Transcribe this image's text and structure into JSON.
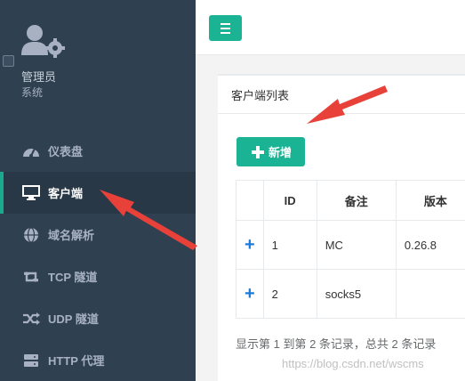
{
  "profile": {
    "name": "管理员",
    "role": "系统"
  },
  "sidebar": {
    "items": [
      {
        "label": "仪表盘",
        "icon": "dashboard-icon"
      },
      {
        "label": "客户端",
        "icon": "monitor-icon",
        "active": true
      },
      {
        "label": "域名解析",
        "icon": "globe-icon"
      },
      {
        "label": "TCP 隧道",
        "icon": "retweet-icon"
      },
      {
        "label": "UDP 隧道",
        "icon": "random-icon"
      },
      {
        "label": "HTTP 代理",
        "icon": "server-icon"
      }
    ]
  },
  "panel": {
    "title": "客户端列表",
    "add_label": "新增"
  },
  "table": {
    "headers": [
      "",
      "ID",
      "备注",
      "版本"
    ],
    "rows": [
      {
        "expand": "+",
        "id": "1",
        "remark": "MC",
        "version": "0.26.8"
      },
      {
        "expand": "+",
        "id": "2",
        "remark": "socks5",
        "version": ""
      }
    ]
  },
  "footer": {
    "summary": "显示第 1 到第 2 条记录，总共 2 条记录"
  },
  "watermark": "https://blog.csdn.net/wscms",
  "colors": {
    "sidebar_bg": "#2f4050",
    "accent": "#1ab394",
    "annotation_arrow": "#e8413a"
  }
}
